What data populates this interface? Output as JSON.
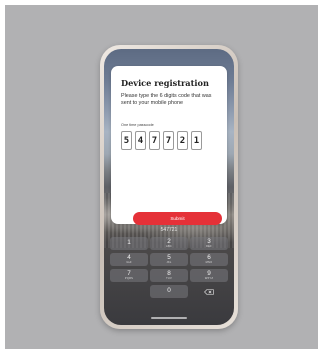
{
  "card": {
    "title": "Device registration",
    "description": "Please type the 6 digits code that was sent to your mobile phone",
    "otp_label": "One time passcode",
    "digits": [
      "5",
      "4",
      "7",
      "7",
      "2",
      "1"
    ],
    "submit_label": "Submit"
  },
  "keyboard": {
    "suggestion": "547721",
    "keys": [
      {
        "num": "1",
        "letters": ""
      },
      {
        "num": "2",
        "letters": "ABC"
      },
      {
        "num": "3",
        "letters": "DEF"
      },
      {
        "num": "4",
        "letters": "GHI"
      },
      {
        "num": "5",
        "letters": "JKL"
      },
      {
        "num": "6",
        "letters": "MNO"
      },
      {
        "num": "7",
        "letters": "PQRS"
      },
      {
        "num": "8",
        "letters": "TUV"
      },
      {
        "num": "9",
        "letters": "WXYZ"
      },
      {
        "num": "0",
        "letters": ""
      }
    ],
    "backspace_icon": "backspace-icon"
  },
  "colors": {
    "accent": "#e53138",
    "background": "#b1b1b3"
  }
}
